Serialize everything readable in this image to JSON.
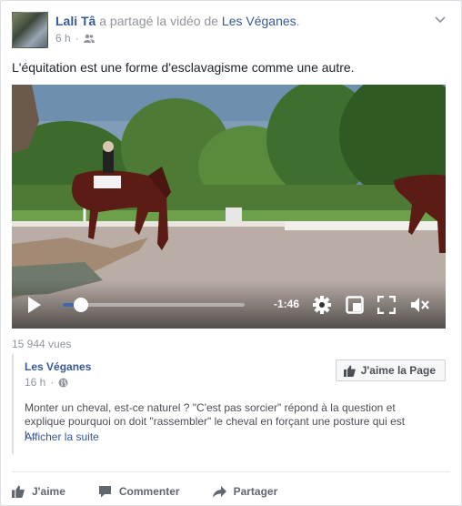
{
  "post": {
    "author": "Lali Tâ",
    "action_text": "a partagé la vidéo de",
    "page_name": "Les Véganes",
    "page_suffix": ".",
    "time": "6 h",
    "audience_icon": "friends-icon",
    "text": "L'équitation est une forme d'esclavagisme comme une autre."
  },
  "video": {
    "time_remaining": "-1:46",
    "progress": 0.1,
    "views": "15 944 vues"
  },
  "shared": {
    "page_name": "Les Véganes",
    "time": "16 h",
    "audience_icon": "globe-icon",
    "like_page_label": "J'aime la Page",
    "description": "Monter un cheval, est-ce naturel ? \"C'est pas sorcier\" répond à la question et explique pourquoi on doit \"rassembler\" le cheval en forçant une posture qui est l...",
    "see_more": "Afficher la suite"
  },
  "actions": {
    "like": "J'aime",
    "comment": "Commenter",
    "share": "Partager"
  },
  "colors": {
    "link": "#365899",
    "muted": "#90949c",
    "action": "#616770",
    "progress": "#4267b2"
  }
}
